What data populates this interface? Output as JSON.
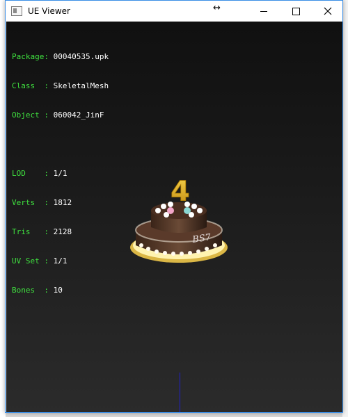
{
  "window": {
    "title": "UE Viewer"
  },
  "info": {
    "package": {
      "key": "Package",
      "value": "00040535.upk"
    },
    "class": {
      "key": "Class  ",
      "value": "SkeletalMesh"
    },
    "object": {
      "key": "Object ",
      "value": "060042_JinF"
    },
    "lod": {
      "key": "LOD    ",
      "value": "1/1"
    },
    "verts": {
      "key": "Verts  ",
      "value": "1812"
    },
    "tris": {
      "key": "Tris   ",
      "value": "2128"
    },
    "uvset": {
      "key": "UV Set ",
      "value": "1/1"
    },
    "bones": {
      "key": "Bones  ",
      "value": "10"
    }
  },
  "cake": {
    "candle_number": "4",
    "plaque_text": "BS7"
  },
  "colors": {
    "info_key": "#3fe03f",
    "info_value": "#ffffff",
    "axis": "#2020d0"
  }
}
